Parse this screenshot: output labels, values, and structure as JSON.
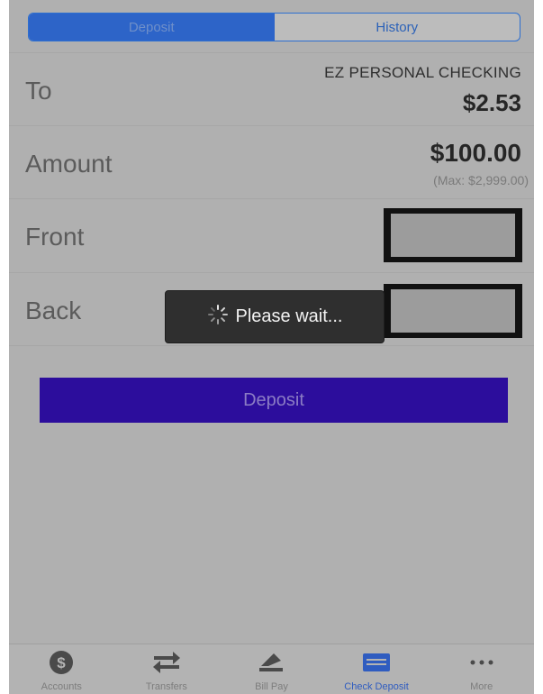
{
  "segment": {
    "deposit_label": "Deposit",
    "history_label": "History",
    "selected": "Deposit"
  },
  "to": {
    "label": "To",
    "account_name": "EZ PERSONAL CHECKING",
    "balance": "$2.53"
  },
  "amount": {
    "label": "Amount",
    "value": "$100.00",
    "max": "(Max: $2,999.00)"
  },
  "front": {
    "label": "Front"
  },
  "back": {
    "label": "Back"
  },
  "deposit_button": {
    "label": "Deposit"
  },
  "toast": {
    "message": "Please wait..."
  },
  "tabbar": {
    "items": [
      {
        "label": "Accounts",
        "icon": "dollar-coin-icon"
      },
      {
        "label": "Transfers",
        "icon": "transfer-arrows-icon"
      },
      {
        "label": "Bill Pay",
        "icon": "bill-pay-icon"
      },
      {
        "label": "Check Deposit",
        "icon": "check-card-icon",
        "active": true
      },
      {
        "label": "More",
        "icon": "more-dots-icon"
      }
    ]
  },
  "colors": {
    "accent_blue": "#2d64c8",
    "deposit_button": "#2c0d9c",
    "overlay_gray": "#b0b0b0",
    "toast_bg": "#2f2f2f"
  }
}
